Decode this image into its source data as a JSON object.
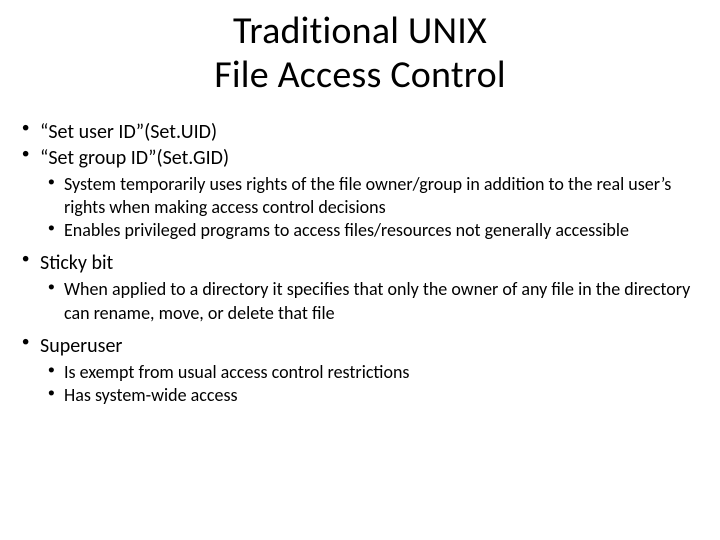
{
  "title_line1": "Traditional UNIX",
  "title_line2": "File Access Control",
  "bullets": {
    "b1": "“Set user ID”(Set.UID)",
    "b2": "“Set group ID”(Set.GID)",
    "b2_sub1": "System temporarily uses rights of the file owner/group in addition to the real user’s rights when making access control decisions",
    "b2_sub2": "Enables privileged programs to access files/resources not generally accessible",
    "b3": "Sticky bit",
    "b3_sub1": "When applied to a directory it specifies that only the owner of any file in the directory can rename, move, or delete that file",
    "b4": "Superuser",
    "b4_sub1": "Is exempt from usual access control restrictions",
    "b4_sub2": "Has system-wide access"
  }
}
